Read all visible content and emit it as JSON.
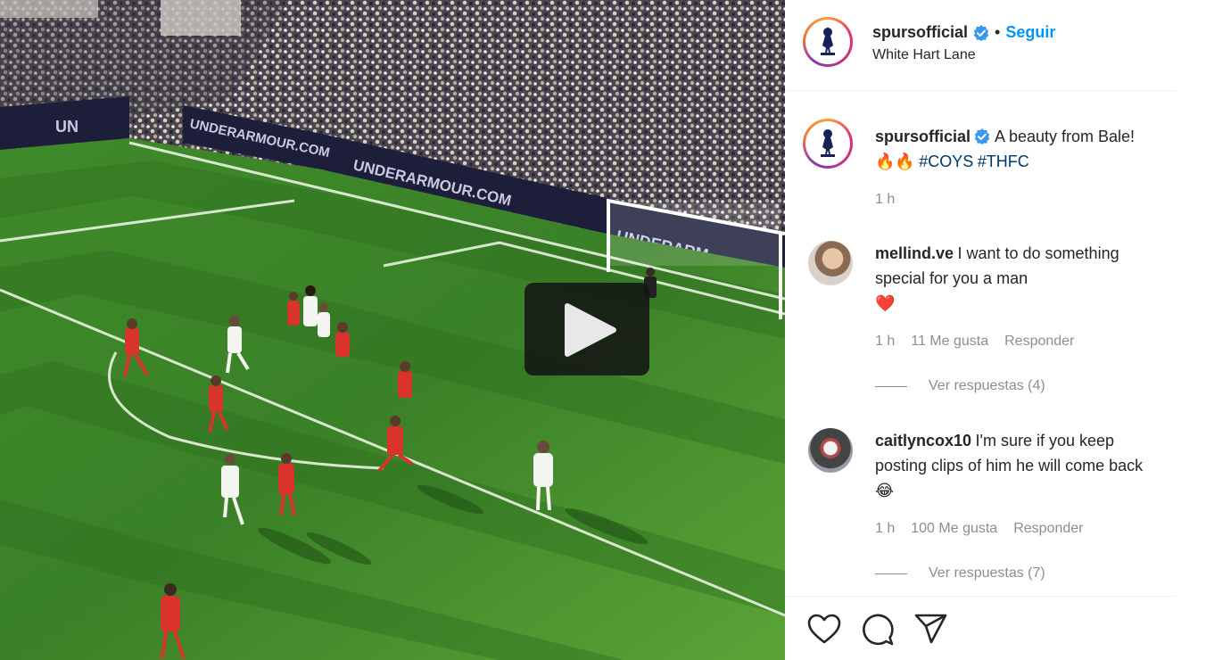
{
  "media": {
    "type": "video",
    "play_icon": "play-icon",
    "board_text": [
      "UNDERARMOUR.COM",
      "UNDERARMOUR.COM",
      "UNDERARM",
      "UN"
    ]
  },
  "post": {
    "author": "spursofficial",
    "separator": "•",
    "follow_label": "Seguir",
    "location": "White Hart Lane",
    "caption": {
      "text": "A beauty from Bale!",
      "emoji": "🔥🔥",
      "hashtags": [
        "#COYS",
        "#THFC"
      ],
      "time": "1 h"
    }
  },
  "comments": [
    {
      "username": "mellind.ve",
      "text": "I want to do something special for you a man",
      "emoji": "❤️",
      "time": "1 h",
      "likes": "11 Me gusta",
      "reply_label": "Responder",
      "view_replies": "Ver respuestas (4)"
    },
    {
      "username": "caitlyncox10",
      "text": "I'm sure if you keep posting clips of him he will come back",
      "emoji": "😂",
      "time": "1 h",
      "likes": "100 Me gusta",
      "reply_label": "Responder",
      "view_replies": "Ver respuestas (7)"
    }
  ],
  "actions": [
    "heart-icon",
    "comment-icon",
    "share-icon"
  ],
  "colors": {
    "accent": "#0095f6",
    "hashtag": "#00376b",
    "muted": "#8e8e8e",
    "heart": "#ed4956"
  }
}
